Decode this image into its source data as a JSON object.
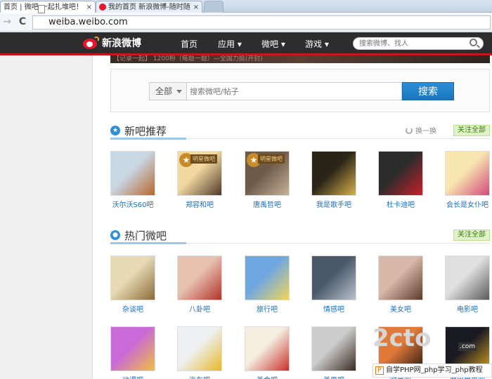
{
  "browser": {
    "tabs": [
      {
        "label": "首页 | 微吧 一起扎堆吧！"
      },
      {
        "label": "我的首页 新浪微博-随时随"
      },
      {
        "label": ""
      }
    ],
    "url": "weiba.weibo.com"
  },
  "weibo_nav": {
    "logo_text": "新浪微博",
    "items": [
      {
        "label": "首页"
      },
      {
        "label": "应用 ▾"
      },
      {
        "label": "微吧 ▾"
      },
      {
        "label": "游戏 ▾"
      }
    ],
    "search_placeholder": "搜索微博、找人"
  },
  "banner": {
    "text": "【记录一起】 1200粉（每题一题）—全国力挺(开封)"
  },
  "search": {
    "scope": "全部",
    "placeholder": "搜索微吧/帖子",
    "button": "搜索"
  },
  "new_bars": {
    "title": "新吧推荐",
    "refresh": "换一换",
    "follow_all": "关注全部",
    "badge_label": "明星微吧",
    "items": [
      {
        "name": "沃尔沃S60吧",
        "colors": [
          "#c9d6e3",
          "#b8662a"
        ]
      },
      {
        "name": "郑容和吧",
        "colors": [
          "#f1d9a0",
          "#4d3a2c"
        ],
        "badge": true
      },
      {
        "name": "唐禹哲吧",
        "colors": [
          "#6d5a48",
          "#c7b29a"
        ],
        "badge": true
      },
      {
        "name": "我是歌手吧",
        "colors": [
          "#2a2418",
          "#d8b24a"
        ]
      },
      {
        "name": "杜卡迪吧",
        "colors": [
          "#2c2c2c",
          "#c8202a"
        ]
      },
      {
        "name": "会长是女仆吧",
        "colors": [
          "#f7e6b0",
          "#d4487a"
        ]
      }
    ]
  },
  "hot_bars": {
    "title": "热门微吧",
    "follow_all": "关注全部",
    "row1": [
      {
        "name": "杂谈吧",
        "colors": [
          "#e7dbb5",
          "#8a6a38"
        ]
      },
      {
        "name": "八卦吧",
        "colors": [
          "#e8c0b0",
          "#b0342a"
        ]
      },
      {
        "name": "旅行吧",
        "colors": [
          "#6fa7e0",
          "#f2d65a"
        ]
      },
      {
        "name": "情感吧",
        "colors": [
          "#4a5868",
          "#b9c3cc"
        ]
      },
      {
        "name": "美女吧",
        "colors": [
          "#d8b8a8",
          "#5a3a2a"
        ]
      },
      {
        "name": "电影吧",
        "colors": [
          "#e0e0e0",
          "#5a5a5a"
        ]
      }
    ],
    "row2": [
      {
        "name": "动漫吧",
        "colors": [
          "#c86ad8",
          "#f0c040"
        ]
      },
      {
        "name": "汽车吧",
        "colors": [
          "#eef0f2",
          "#e8b82a"
        ]
      },
      {
        "name": "美食吧",
        "colors": [
          "#f4ede0",
          "#c8302a"
        ]
      },
      {
        "name": "美男吧",
        "colors": [
          "#ccc",
          "#3a2a22"
        ]
      },
      {
        "name": "时尚吧",
        "colors": [
          "#e07a3a",
          "#2a1a14"
        ]
      },
      {
        "name": "魔兽世界吧",
        "colors": [
          "#1a1a22",
          "#d4a020"
        ]
      }
    ]
  },
  "watermark": {
    "logo": "ꜰ2ᴄᴛo",
    "sub": ".com",
    "ad_text": "自学PHP网_php学习_php教程"
  }
}
